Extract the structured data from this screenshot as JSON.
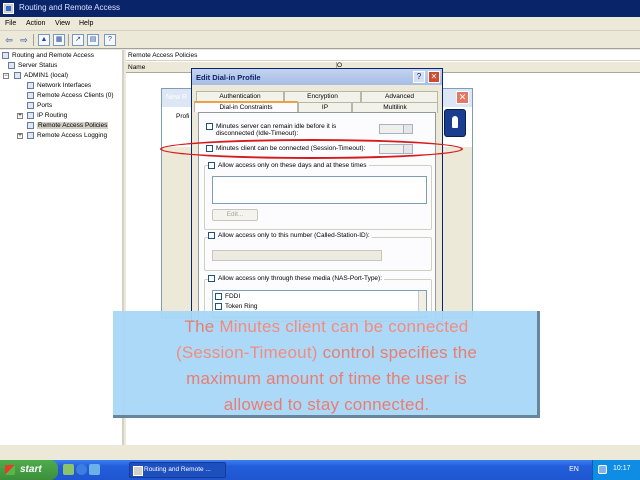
{
  "window": {
    "title": "Routing and Remote Access"
  },
  "menu": [
    "File",
    "Action",
    "View",
    "Help"
  ],
  "toolbar": {
    "buttons": [
      "back-icon",
      "forward-icon",
      "up-folder-icon",
      "show-hide-tree-icon",
      "export-list-icon",
      "properties-icon",
      "help-icon"
    ]
  },
  "tree": {
    "items": [
      {
        "label": "Routing and Remote Access",
        "icon": "rras-icon"
      },
      {
        "label": "Server Status",
        "icon": "server-status-icon"
      },
      {
        "label": "ADMIN1 (local)",
        "icon": "server-icon"
      },
      {
        "label": "Network Interfaces",
        "icon": "network-interfaces-icon"
      },
      {
        "label": "Remote Access Clients (0)",
        "icon": "clients-icon"
      },
      {
        "label": "Ports",
        "icon": "ports-icon"
      },
      {
        "label": "IP Routing",
        "icon": "ip-routing-icon"
      },
      {
        "label": "Remote Access Policies",
        "icon": "policies-icon"
      },
      {
        "label": "Remote Access Logging",
        "icon": "logging-icon"
      }
    ]
  },
  "right_pane": {
    "header": "Remote Access Policies",
    "columns": [
      "Name",
      "O"
    ]
  },
  "wizard": {
    "title": "New R",
    "body_text": "Profi"
  },
  "dialog": {
    "title": "Edit Dial-in Profile",
    "help_button": "?",
    "close_button": "✕",
    "tabs_row1": [
      "Authentication",
      "Encryption",
      "Advanced"
    ],
    "tabs_row2": [
      "Dial-in Constraints",
      "IP",
      "Multilink"
    ],
    "idle_label": "Minutes server can remain idle before it is disconnected (Idle-Timeout):",
    "session_label": "Minutes client can be connected (Session-Timeout):",
    "days_label": "Allow access only on these days and at these times",
    "edit_button": "Edit...",
    "station_label": "Allow access only to this number (Called-Station-ID):",
    "media_label": "Allow access only through these media (NAS-Port-Type):",
    "media_options": [
      "FDDI",
      "Token Ring"
    ]
  },
  "callout": {
    "line1_pre": "The ",
    "line1_highlight": "Minutes client can be connected",
    "line2_highlight": "(Session-Timeout)",
    "line2_post": " control specifies the",
    "line3": "maximum amount of time the user is",
    "line4": "allowed to stay connected."
  },
  "taskbar": {
    "start": "start",
    "task_button": "Routing and Remote ...",
    "language": "EN",
    "clock": "10:17"
  },
  "colors": {
    "highlight_ellipse": "#d71b1b",
    "callout_bg": "#a8d8f7",
    "callout_text": "#e8776a"
  }
}
